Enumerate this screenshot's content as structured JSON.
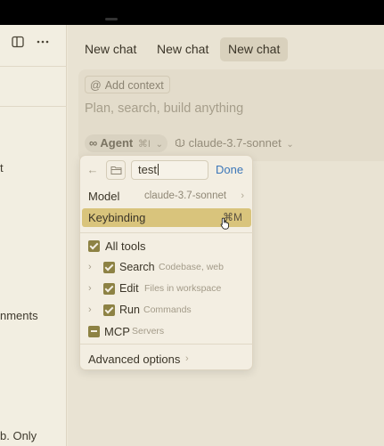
{
  "sidebar": {
    "icons": [
      "sidebar-toggle-icon",
      "more-options-icon"
    ],
    "fragments": [
      "t",
      "nments",
      "b. Only"
    ]
  },
  "tabs": [
    {
      "label": "New chat",
      "active": false
    },
    {
      "label": "New chat",
      "active": false
    },
    {
      "label": "New chat",
      "active": true
    }
  ],
  "composer": {
    "add_context": "Add context",
    "placeholder": "Plan, search, build anything",
    "mode": "Agent",
    "mode_shortcut": "⌘I",
    "model": "claude-3.7-sonnet"
  },
  "popover": {
    "search_value": "test",
    "done_label": "Done",
    "model_label": "Model",
    "model_value": "claude-3.7-sonnet",
    "keybinding_label": "Keybinding",
    "keybinding_value": "⌘M",
    "all_tools_label": "All tools",
    "tools": [
      {
        "name": "Search",
        "desc": "Codebase, web"
      },
      {
        "name": "Edit",
        "desc": "Files in workspace"
      },
      {
        "name": "Run",
        "desc": "Commands"
      }
    ],
    "mcp": {
      "name": "MCP",
      "desc": "Servers"
    },
    "advanced_label": "Advanced options"
  },
  "colors": {
    "accent": "#8d8244",
    "highlight": "#d9c47c",
    "link": "#3c77b8"
  }
}
